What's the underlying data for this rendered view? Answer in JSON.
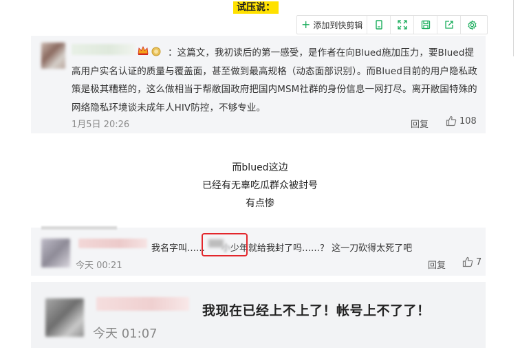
{
  "heading": "试压说：",
  "toolbar": {
    "add_label": "添加到快剪辑",
    "icons": [
      "plus-icon",
      "copy-page-icon",
      "expand-icon",
      "save-icon",
      "share-icon",
      "settings-icon"
    ]
  },
  "comment1": {
    "text": "：这篇文，我初读后的第一感受，是作者在向Blued施加压力，要Blued提高用户实名认证的质量与覆盖面，甚至做到最高规格（动态面部识别）。而Blued目前的用户隐私政策是极其糟糕的，这么做相当于帮敝国政府把国内MSM社群的身份信息一网打尽。离开敝国特殊的网络隐私环境谈未成年人HIV防控，不够专业。",
    "time": "1月5日 20:26",
    "reply": "回复",
    "likes": "108"
  },
  "middle": {
    "line1": "而blued这边",
    "line2": "已经有无辜吃瓜群众被封号",
    "line3": "有点惨"
  },
  "comment2": {
    "text_before": "我名字叫……",
    "text_blurred": "小",
    "text_after": "少年就给我封了吗……？ 这一刀砍得太死了吧",
    "time": "今天 00:21",
    "reply": "回复",
    "likes": "7"
  },
  "comment3": {
    "text": "我现在已经上不上了！帐号上不了了！",
    "time": "今天 01:07"
  },
  "colors": {
    "highlight": "#ffe100",
    "card_bg": "#f4f5f7",
    "red_box": "#e3262b",
    "toolbar_accent": "#1aad5c"
  }
}
